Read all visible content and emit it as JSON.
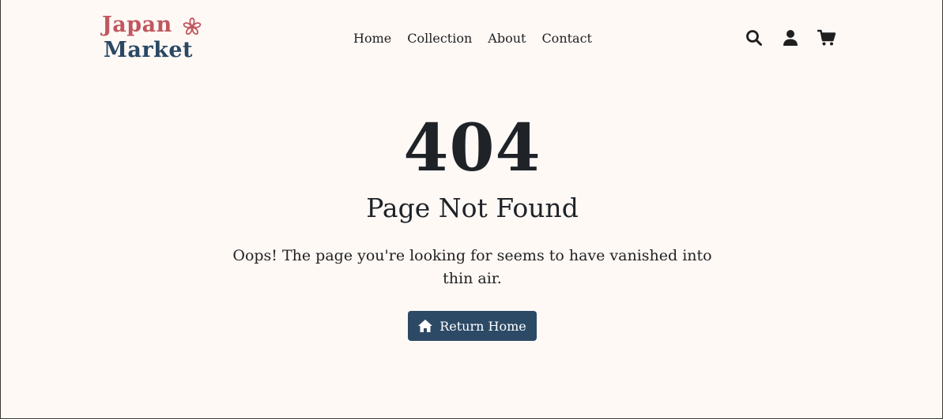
{
  "brand": {
    "line1": "Japan",
    "line2": "Market",
    "line1_color": "#c0575e",
    "line2_color": "#2a4863",
    "flower_icon": "sakura-icon"
  },
  "nav": {
    "links": [
      "Home",
      "Collection",
      "About",
      "Contact"
    ],
    "icons": [
      "search-icon",
      "user-icon",
      "cart-icon"
    ]
  },
  "error": {
    "code": "404",
    "title": "Page Not Found",
    "message": "Oops! The page you're looking for seems to have vanished into thin air."
  },
  "button": {
    "label": "Return Home",
    "icon": "home-icon",
    "color": "#2c4a66"
  },
  "colors": {
    "background": "#fff9f6",
    "text": "#1f2328"
  }
}
